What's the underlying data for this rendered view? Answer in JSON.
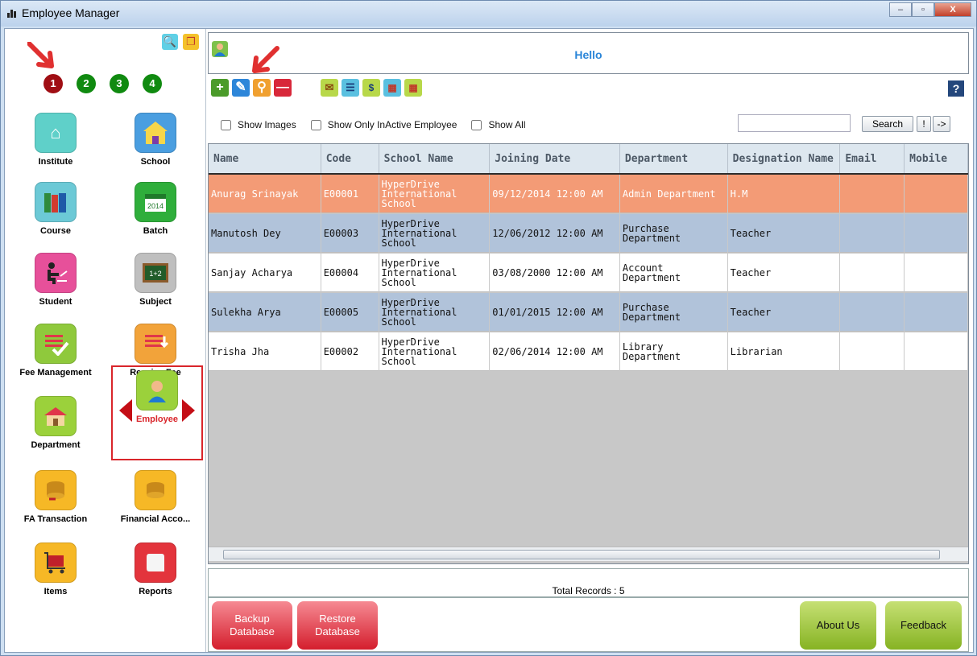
{
  "window": {
    "title": "Employee Manager",
    "min": "‒",
    "max": "▫",
    "close": "X"
  },
  "sidebar": {
    "pages": [
      "1",
      "2",
      "3",
      "4"
    ],
    "tiles": [
      {
        "label": "Institute",
        "icon": "house-icon",
        "color": "#5fd0c9"
      },
      {
        "label": "School",
        "icon": "school-icon",
        "color": "#4a9ee0"
      },
      {
        "label": "Course",
        "icon": "books-icon",
        "color": "#6cc9d6"
      },
      {
        "label": "Batch",
        "icon": "calendar-icon",
        "color": "#2fae3b"
      },
      {
        "label": "Student",
        "icon": "student-icon",
        "color": "#e7509a"
      },
      {
        "label": "Subject",
        "icon": "blackboard-icon",
        "color": "#bfbfbf"
      },
      {
        "label": "Fee Management",
        "icon": "fee-icon",
        "color": "#8fc93c"
      },
      {
        "label": "Receive Fee",
        "icon": "receive-fee-icon",
        "color": "#f2a33a"
      },
      {
        "label": "Department",
        "icon": "department-icon",
        "color": "#9bd13b"
      },
      {
        "label": "Employee",
        "icon": "employee-icon",
        "color": "#9bd13b"
      },
      {
        "label": "FA Transaction",
        "icon": "fa-transaction-icon",
        "color": "#f6b826"
      },
      {
        "label": "Financial Acco...",
        "icon": "coins-icon",
        "color": "#f6b826"
      },
      {
        "label": "Items",
        "icon": "cart-icon",
        "color": "#f6b826"
      },
      {
        "label": "Reports",
        "icon": "reports-icon",
        "color": "#e3343c"
      }
    ]
  },
  "header": {
    "greeting": "Hello"
  },
  "filters": {
    "show_images": "Show Images",
    "show_inactive": "Show Only InActive Employee",
    "show_all": "Show All"
  },
  "search": {
    "button": "Search",
    "btn2": "!",
    "btn3": "->"
  },
  "table": {
    "columns": [
      "Name",
      "Code",
      "School Name",
      "Joining Date",
      "Department",
      "Designation Name",
      "Email",
      "Mobile"
    ],
    "rows": [
      {
        "name": "Anurag Srinayak",
        "code": "E00001",
        "school": "HyperDrive International School",
        "joining": "09/12/2014 12:00 AM",
        "dept": "Admin Department",
        "desig": "H.M",
        "email": "",
        "mobile": ""
      },
      {
        "name": "Manutosh Dey",
        "code": "E00003",
        "school": "HyperDrive International School",
        "joining": "12/06/2012 12:00 AM",
        "dept": "Purchase Department",
        "desig": "Teacher",
        "email": "",
        "mobile": ""
      },
      {
        "name": "Sanjay Acharya",
        "code": "E00004",
        "school": "HyperDrive International School",
        "joining": "03/08/2000 12:00 AM",
        "dept": "Account Department",
        "desig": "Teacher",
        "email": "",
        "mobile": ""
      },
      {
        "name": "Sulekha Arya",
        "code": "E00005",
        "school": "HyperDrive International School",
        "joining": "01/01/2015 12:00 AM",
        "dept": "Purchase Department",
        "desig": "Teacher",
        "email": "",
        "mobile": ""
      },
      {
        "name": "Trisha Jha",
        "code": "E00002",
        "school": "HyperDrive International School",
        "joining": "02/06/2014 12:00 AM",
        "dept": "Library Department",
        "desig": "Librarian",
        "email": "",
        "mobile": ""
      }
    ],
    "total": "Total Records : 5"
  },
  "footer": {
    "backup": "Backup Database",
    "restore": "Restore Database",
    "about": "About Us",
    "feedback": "Feedback"
  }
}
